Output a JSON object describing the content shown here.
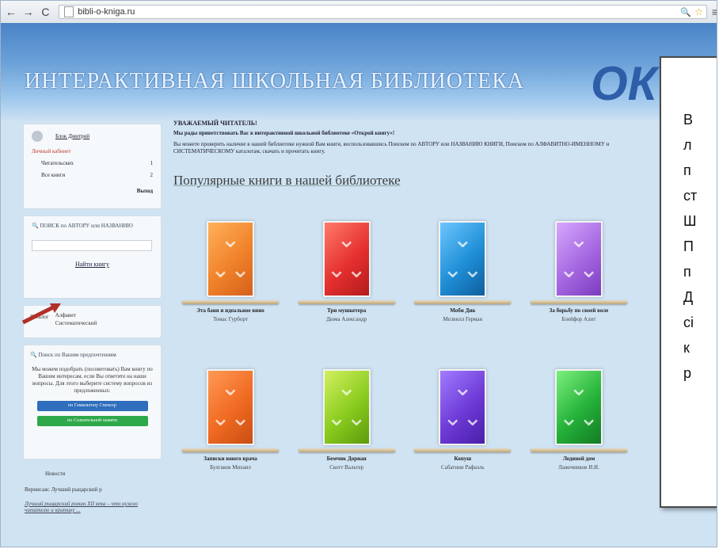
{
  "browser": {
    "url": "bibli-o-kniga.ru"
  },
  "header": {
    "site_title": "ИНТЕРАКТИВНАЯ ШКОЛЬНАЯ БИБЛИОТЕКА",
    "logo": "ОК"
  },
  "sidebar": {
    "login": {
      "username": "Блок Дмитрий",
      "cabinet": "Личный кабинет",
      "rows": [
        {
          "label": "Читательских",
          "value": "1"
        },
        {
          "label": "Все книги",
          "value": "2"
        }
      ],
      "exit": "Выход"
    },
    "search": {
      "caption": "ПОИСК по АВТОРУ или НАЗВАНИЮ",
      "button": "Найти книгу"
    },
    "sort": {
      "label": "Каталог",
      "options": [
        "Алфавит",
        "Систематический"
      ]
    },
    "interest": {
      "caption": "Поиск по Вашим предпочтениям",
      "description": "Мы можем подобрать (посоветовать) Вам книгу по Вашим интересам, если Вы ответите на наши вопросы. Для этого выберите систему вопросов из предложенных:",
      "btn_blue": "по Гамильтону Спенсер",
      "btn_green": "по Сознательной памяти"
    },
    "news": {
      "title": "Новости",
      "line": "Вернисаж: Лучший рыцарский р",
      "link": "Лучший рыцарский роман XII века – что нужно читателю и критику ..."
    }
  },
  "main": {
    "greet_title": "УВАЖАЕМЫЙ ЧИТАТЕЛЬ!",
    "greet_text": "Мы рады приветствовать Вас в интерактивной школьной библиотеке «Открой книгу»!",
    "greet_text2": "Вы можете проверить наличие в нашей библиотеке нужной Вам книги, воспользовавшись Поиском по АВТОРУ или НАЗВАНИЮ КНИГИ, Поиском по АЛФАВИТНО-ИМЕННОМУ и СИСТЕМАТИЧЕСКОМУ каталогам, скачать и прочитать книгу.",
    "popular": "Популярные книги в нашей библиотеке",
    "books_row1": [
      {
        "title": "Эта баня и идеальное вино",
        "author": "Томас Гурборт",
        "color": "#f0822a"
      },
      {
        "title": "Три мушкетера",
        "author": "Дюма Александр",
        "color": "#e5302f"
      },
      {
        "title": "Моби Дик",
        "author": "Мелвилл Герман",
        "color": "#1f8fd6"
      },
      {
        "title": "За борьбу по своей воле",
        "author": "Блейфор Алит",
        "color": "#a567e0"
      }
    ],
    "books_row2": [
      {
        "title": "Записки юного врача",
        "author": "Булгаков Михаил",
        "color": "#f06a22"
      },
      {
        "title": "Бемчик Дориан",
        "author": "Скотт Вальтер",
        "color": "#8acb1e"
      },
      {
        "title": "Копуш",
        "author": "Сабатини Рафаэль",
        "color": "#6d3ad6"
      },
      {
        "title": "Ледяной дом",
        "author": "Лажечников И.И.",
        "color": "#25b23a"
      }
    ]
  },
  "callout": {
    "lines": [
      "В",
      "л",
      "п",
      "ст",
      "Ш",
      "П",
      "п",
      "Д",
      "сі",
      "к",
      "р"
    ]
  }
}
